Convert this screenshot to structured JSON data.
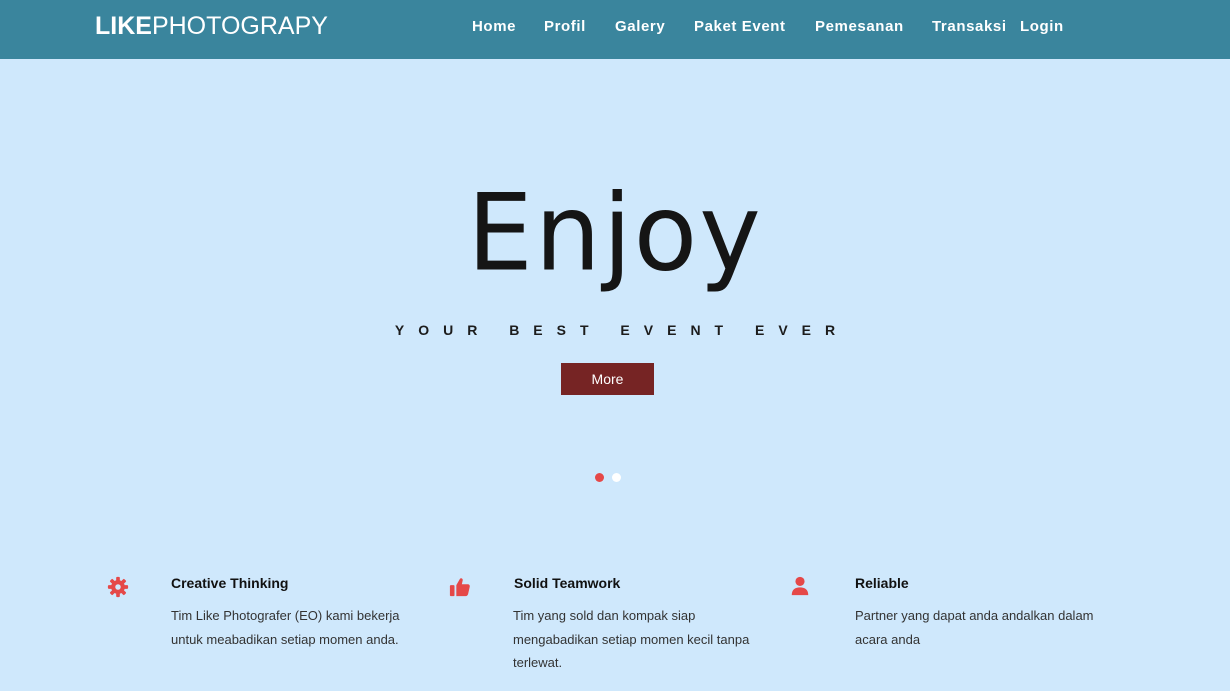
{
  "brand": {
    "bold": "LIKE",
    "light": "PHOTOGRAPY"
  },
  "nav": {
    "home": "Home",
    "profil": "Profil",
    "galery": "Galery",
    "paket_event": "Paket Event",
    "pemesanan": "Pemesanan",
    "transaksi": "Transaksi",
    "login": "Login"
  },
  "hero": {
    "title": "Enjoy",
    "subtitle": "YOUR BEST EVENT EVER",
    "button": "More",
    "slides_total": 2,
    "slide_active": 1
  },
  "features": [
    {
      "icon": "gear-icon",
      "title": "Creative Thinking",
      "desc_line1": "Tim Like Photografer (EO) kami bekerja",
      "desc_line2": "untuk meabadikan setiap momen anda."
    },
    {
      "icon": "thumbs-up-icon",
      "title": "Solid Teamwork",
      "desc_line1": "Tim yang sold dan kompak siap",
      "desc_line2": "mengabadikan setiap momen kecil tanpa",
      "desc_line3": "terlewat."
    },
    {
      "icon": "user-icon",
      "title": "Reliable",
      "desc_line1": "Partner yang dapat anda andalkan dalam",
      "desc_line2": "acara anda"
    }
  ],
  "colors": {
    "navbar": "#3a859d",
    "background": "#cfe8fc",
    "button": "#762424",
    "icon_accent": "#e54848"
  }
}
